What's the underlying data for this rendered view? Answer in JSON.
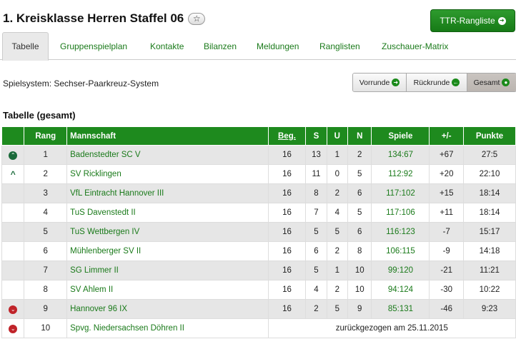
{
  "header": {
    "title": "1. Kreisklasse Herren Staffel 06",
    "star_icon": "star-icon",
    "ttr_button": "TTR-Rangliste"
  },
  "tabs": [
    {
      "label": "Tabelle",
      "active": true
    },
    {
      "label": "Gruppenspielplan"
    },
    {
      "label": "Kontakte"
    },
    {
      "label": "Bilanzen"
    },
    {
      "label": "Meldungen"
    },
    {
      "label": "Ranglisten"
    },
    {
      "label": "Zuschauer-Matrix"
    }
  ],
  "spielsystem": "Spielsystem: Sechser-Paarkreuz-System",
  "segments": [
    {
      "label": "Vorrunde",
      "icon": "arrow-right-circle-icon"
    },
    {
      "label": "Rückrunde",
      "icon": "arrow-left-circle-icon"
    },
    {
      "label": "Gesamt",
      "icon": "dot-circle-icon",
      "active": true
    }
  ],
  "section_title": "Tabelle (gesamt)",
  "table": {
    "headers": [
      "",
      "Rang",
      "Mannschaft",
      "Beg.",
      "S",
      "U",
      "N",
      "Spiele",
      "+/-",
      "Punkte"
    ],
    "rows": [
      {
        "marker": "up-circle",
        "rang": "1",
        "team": "Badenstedter SC V",
        "beg": "16",
        "s": "13",
        "u": "1",
        "n": "2",
        "spiele": "134:67",
        "diff": "+67",
        "punkte": "27:5"
      },
      {
        "marker": "up-chevron",
        "rang": "2",
        "team": "SV Ricklingen",
        "beg": "16",
        "s": "11",
        "u": "0",
        "n": "5",
        "spiele": "112:92",
        "diff": "+20",
        "punkte": "22:10"
      },
      {
        "marker": "",
        "rang": "3",
        "team": "VfL Eintracht Hannover III",
        "beg": "16",
        "s": "8",
        "u": "2",
        "n": "6",
        "spiele": "117:102",
        "diff": "+15",
        "punkte": "18:14"
      },
      {
        "marker": "",
        "rang": "4",
        "team": "TuS Davenstedt II",
        "beg": "16",
        "s": "7",
        "u": "4",
        "n": "5",
        "spiele": "117:106",
        "diff": "+11",
        "punkte": "18:14"
      },
      {
        "marker": "",
        "rang": "5",
        "team": "TuS Wettbergen IV",
        "beg": "16",
        "s": "5",
        "u": "5",
        "n": "6",
        "spiele": "116:123",
        "diff": "-7",
        "punkte": "15:17"
      },
      {
        "marker": "",
        "rang": "6",
        "team": "Mühlenberger SV II",
        "beg": "16",
        "s": "6",
        "u": "2",
        "n": "8",
        "spiele": "106:115",
        "diff": "-9",
        "punkte": "14:18"
      },
      {
        "marker": "",
        "rang": "7",
        "team": "SG Limmer II",
        "beg": "16",
        "s": "5",
        "u": "1",
        "n": "10",
        "spiele": "99:120",
        "diff": "-21",
        "punkte": "11:21"
      },
      {
        "marker": "",
        "rang": "8",
        "team": "SV Ahlem II",
        "beg": "16",
        "s": "4",
        "u": "2",
        "n": "10",
        "spiele": "94:124",
        "diff": "-30",
        "punkte": "10:22"
      },
      {
        "marker": "down-circle",
        "rang": "9",
        "team": "Hannover 96 IX",
        "beg": "16",
        "s": "2",
        "u": "5",
        "n": "9",
        "spiele": "85:131",
        "diff": "-46",
        "punkte": "9:23"
      }
    ],
    "withdrawn": {
      "marker": "down-circle",
      "rang": "10",
      "team": "Spvg. Niedersachsen Döhren II",
      "note": "zurückgezogen am 25.11.2015"
    }
  },
  "colors": {
    "green": "#1e8a1e",
    "link_green": "#1a7a1a",
    "down_red": "#c0242a"
  }
}
